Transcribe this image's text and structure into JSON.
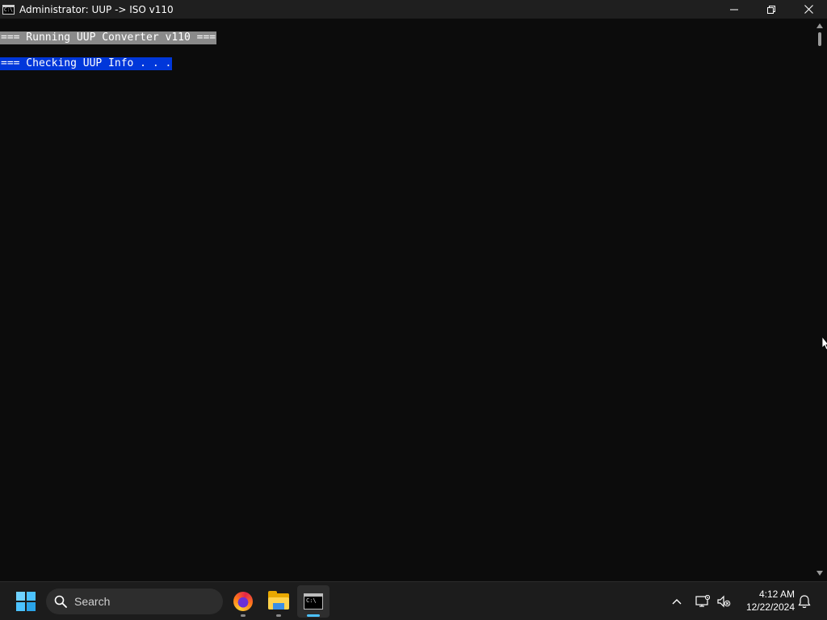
{
  "window": {
    "title": "Administrator:  UUP -> ISO v110",
    "icon_text": "C:\\",
    "controls": [
      "minimize-icon",
      "restore-icon",
      "close-icon"
    ]
  },
  "console": {
    "lines": [
      {
        "text": "=== Running UUP Converter v110 ===",
        "highlight": "gray"
      },
      {
        "text": "=== Checking UUP Info . . .",
        "highlight": "blue"
      }
    ]
  },
  "taskbar": {
    "search_placeholder": "Search",
    "apps": [
      {
        "name": "Firefox",
        "icon": "firefox-icon",
        "running": true,
        "active": false
      },
      {
        "name": "File Explorer",
        "icon": "folder-icon",
        "running": true,
        "active": false
      },
      {
        "name": "Command Prompt",
        "icon": "cmd-icon",
        "running": true,
        "active": true
      }
    ],
    "clock": {
      "time": "4:12 AM",
      "date": "12/22/2024"
    }
  },
  "colors": {
    "console_bg": "#0c0c0c",
    "highlight_gray": "#8a8a8a",
    "highlight_blue": "#0037da",
    "titlebar_bg": "#1f1f1f",
    "taskbar_bg": "#1c1c1c",
    "accent": "#4cc2ff"
  }
}
